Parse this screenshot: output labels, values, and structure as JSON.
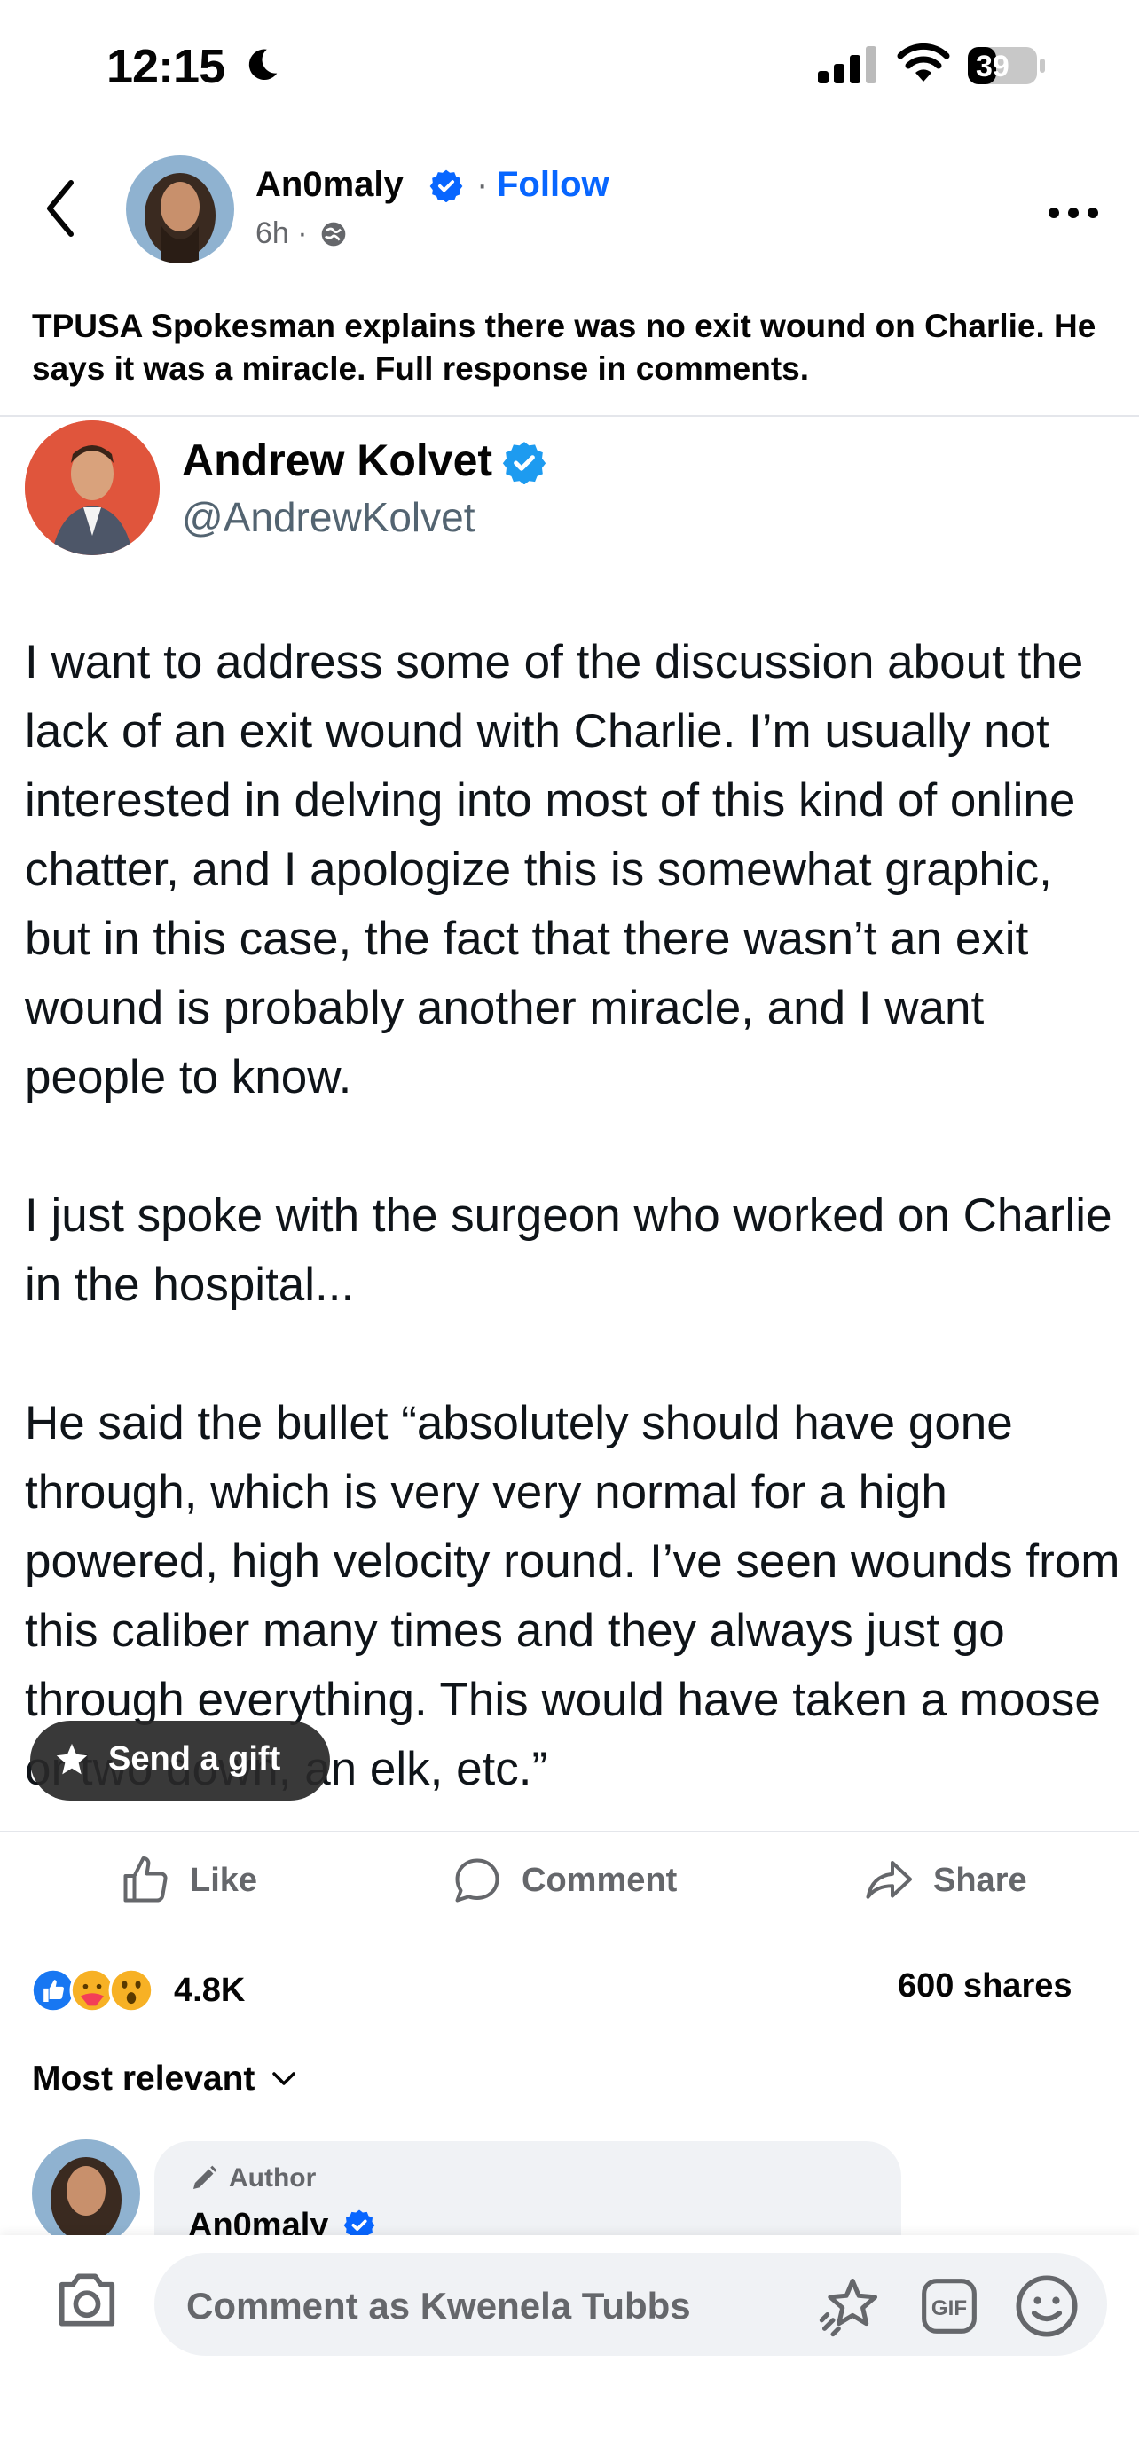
{
  "status_bar": {
    "time": "12:15",
    "battery": "39"
  },
  "post": {
    "author": "An0maly",
    "follow_label": "Follow",
    "separator": "·",
    "age": "6h ·",
    "caption": "TPUSA Spokesman explains there was no exit wound on Charlie. He says it was a miracle. Full response in comments."
  },
  "tweet": {
    "name": "Andrew Kolvet",
    "handle": "@AndrewKolvet",
    "body": "I want to address some of the discussion about the lack of an exit wound with Charlie. I’m usually not interested in delving into most of this kind of online chatter, and I apologize this is somewhat graphic, but in this case, the fact that there wasn’t an exit wound is probably another miracle, and I want people to know.\n\nI just spoke with the surgeon who worked on Charlie in the hospital...\n\nHe said the bullet “absolutely should have gone through, which is very very normal for a high powered, high velocity round. I’ve seen wounds from this caliber many times and they always just go through everything. This would have taken a moose or two down, an elk, etc.”"
  },
  "gift_button": {
    "label": "Send a gift"
  },
  "actions": {
    "like": "Like",
    "comment": "Comment",
    "share": "Share"
  },
  "stats": {
    "reactions": "4.8K",
    "shares": "600 shares"
  },
  "sort": {
    "label": "Most relevant"
  },
  "comment": {
    "badge": "Author",
    "name": "An0maly"
  },
  "composer": {
    "placeholder": "Comment as Kwenela Tubbs"
  },
  "colors": {
    "accent": "#0866ff",
    "verified": "#0866ff",
    "twitter_verified": "#1d9bf0"
  }
}
